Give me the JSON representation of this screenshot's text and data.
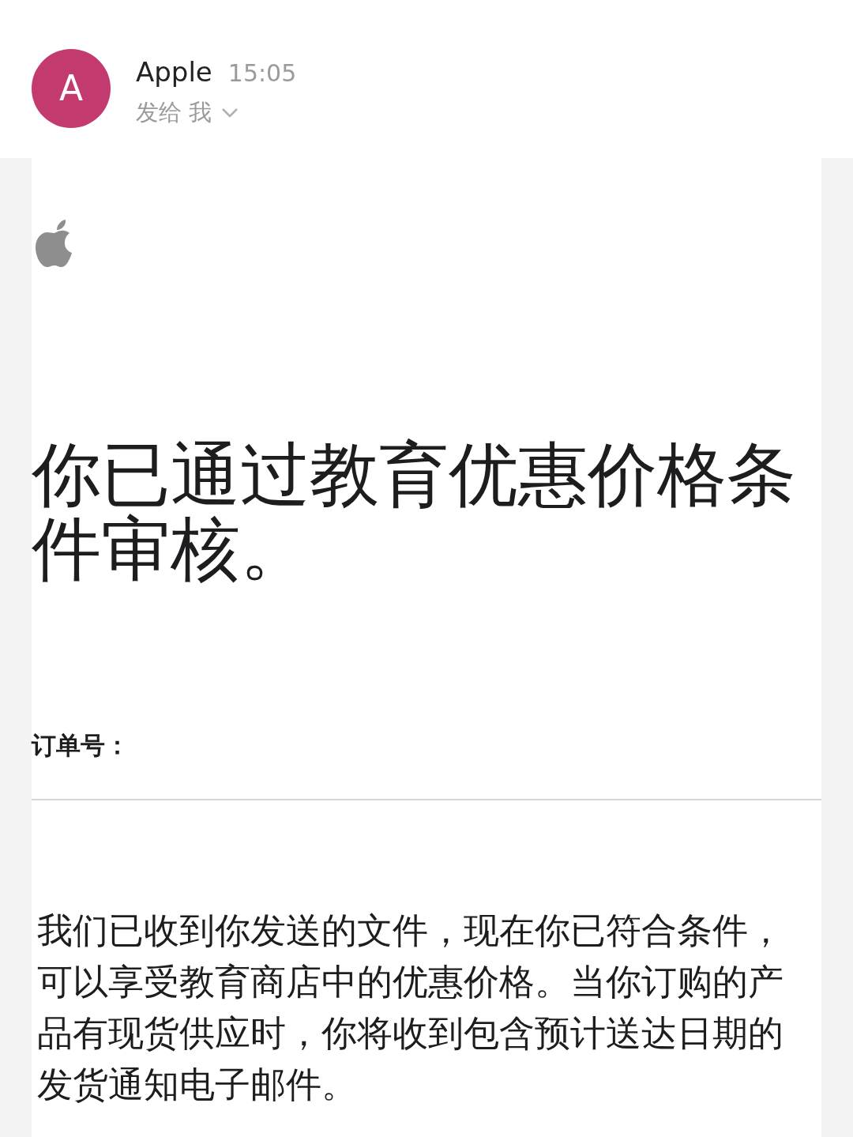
{
  "header": {
    "avatar_letter": "A",
    "sender": "Apple",
    "time": "15:05",
    "recipient": "发给 我"
  },
  "body": {
    "title": "你已通过教育优惠价格条件审核。",
    "order_label": "订单号：",
    "message": "我们已收到你发送的文件，现在你已符合条件，可以享受教育商店中的优惠价格。当你订购的产品有现货供应时，你将收到包含预计送达日期的发货通知电子邮件。"
  }
}
